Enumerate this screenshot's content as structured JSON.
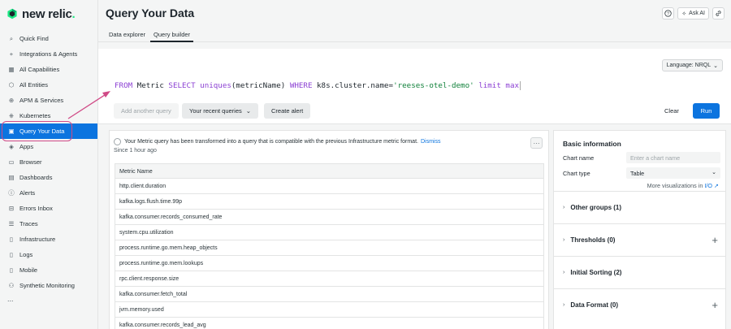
{
  "brand": {
    "logo_text": "new relic",
    "logo_dot": "."
  },
  "sidebar": {
    "items": [
      {
        "label": "Quick Find",
        "icon": "search-icon"
      },
      {
        "label": "Integrations & Agents",
        "icon": "plus-icon"
      },
      {
        "label": "All Capabilities",
        "icon": "grid-icon"
      },
      {
        "label": "All Entities",
        "icon": "entities-icon"
      },
      {
        "label": "APM & Services",
        "icon": "globe-icon"
      },
      {
        "label": "Kubernetes",
        "icon": "kubernetes-icon"
      },
      {
        "label": "Query Your Data",
        "icon": "query-icon",
        "active": true
      },
      {
        "label": "Apps",
        "icon": "apps-icon"
      },
      {
        "label": "Browser",
        "icon": "browser-icon"
      },
      {
        "label": "Dashboards",
        "icon": "dashboard-icon"
      },
      {
        "label": "Alerts",
        "icon": "alert-icon"
      },
      {
        "label": "Errors Inbox",
        "icon": "inbox-icon"
      },
      {
        "label": "Traces",
        "icon": "traces-icon"
      },
      {
        "label": "Infrastructure",
        "icon": "infrastructure-icon"
      },
      {
        "label": "Logs",
        "icon": "logs-icon"
      },
      {
        "label": "Mobile",
        "icon": "mobile-icon"
      },
      {
        "label": "Synthetic Monitoring",
        "icon": "synthetic-icon"
      }
    ],
    "more": "..."
  },
  "header": {
    "title": "Query Your Data",
    "ask_ai": "Ask AI"
  },
  "tabs": [
    {
      "label": "Data explorer",
      "active": false
    },
    {
      "label": "Query builder",
      "active": true
    }
  ],
  "query": {
    "language": "Language: NRQL",
    "tokens": [
      {
        "t": "FROM",
        "c": "kw"
      },
      {
        "t": " Metric ",
        "c": ""
      },
      {
        "t": "SELECT",
        "c": "kw"
      },
      {
        "t": " ",
        "c": ""
      },
      {
        "t": "uniques",
        "c": "fn"
      },
      {
        "t": "(metricName) ",
        "c": ""
      },
      {
        "t": "WHERE",
        "c": "kw"
      },
      {
        "t": " k8s.cluster.name=",
        "c": ""
      },
      {
        "t": "'reeses-otel-demo'",
        "c": "str"
      },
      {
        "t": " ",
        "c": ""
      },
      {
        "t": "limit",
        "c": "kw"
      },
      {
        "t": " ",
        "c": ""
      },
      {
        "t": "max",
        "c": "kw"
      }
    ],
    "add_another": "Add another query",
    "recent": "Your recent queries",
    "create_alert": "Create alert",
    "clear": "Clear",
    "run": "Run"
  },
  "results": {
    "notice": "Your Metric query has been transformed into a query that is compatible with the previous Infrastructure metric format.",
    "dismiss": "Dismiss",
    "since": "Since 1 hour ago",
    "column": "Metric Name",
    "rows": [
      "http.client.duration",
      "kafka.logs.flush.time.99p",
      "kafka.consumer.records_consumed_rate",
      "system.cpu.utilization",
      "process.runtime.go.mem.heap_objects",
      "process.runtime.go.mem.lookups",
      "rpc.client.response.size",
      "kafka.consumer.fetch_total",
      "jvm.memory.used",
      "kafka.consumer.records_lead_avg"
    ]
  },
  "options": {
    "title": "Basic information",
    "chart_name_label": "Chart name",
    "chart_name_placeholder": "Enter a chart name",
    "chart_type_label": "Chart type",
    "chart_type_value": "Table",
    "more_viz": "More visualizations in",
    "more_viz_link": "I/O",
    "sections": [
      {
        "label": "Other groups (1)",
        "plus": false
      },
      {
        "label": "Thresholds (0)",
        "plus": true
      },
      {
        "label": "Initial Sorting (2)",
        "plus": false
      },
      {
        "label": "Data Format (0)",
        "plus": true
      }
    ]
  }
}
